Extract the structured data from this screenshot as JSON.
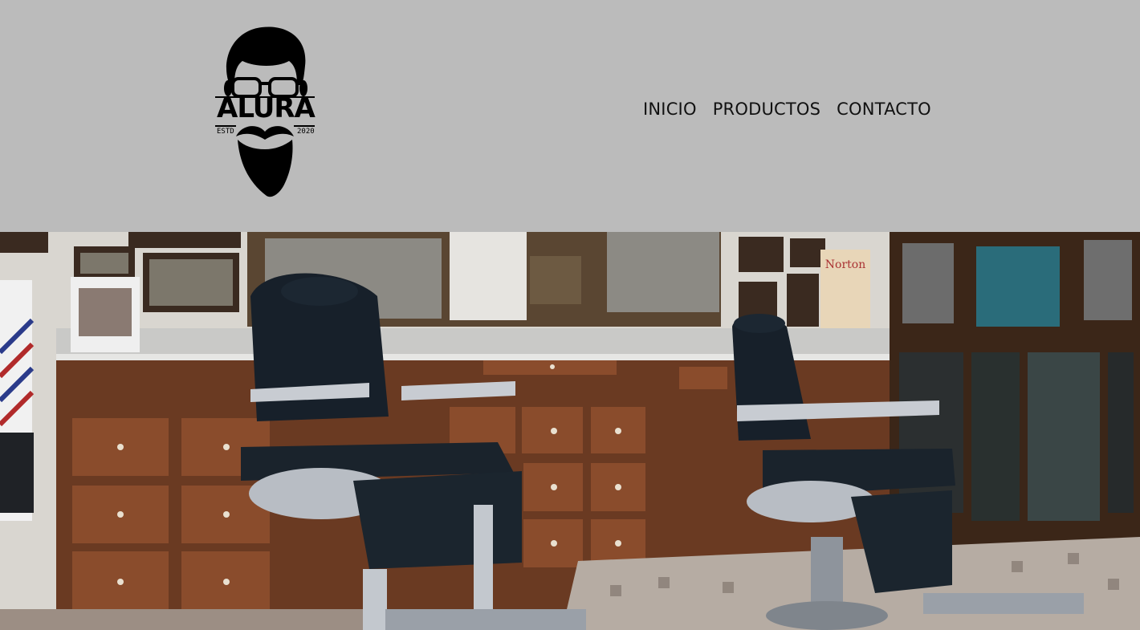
{
  "brand": {
    "name": "ALURA",
    "estd_label": "ESTD",
    "year": "2020",
    "logo_icon": "bearded-man-with-glasses-icon"
  },
  "nav": {
    "items": [
      {
        "label": "INICIO"
      },
      {
        "label": "PRODUCTOS"
      },
      {
        "label": "CONTACTO"
      }
    ]
  },
  "hero": {
    "image_icon": "barbershop-photo",
    "sign_text": "Norton"
  },
  "colors": {
    "header_bg": "#bbbbbb",
    "nav_text": "#111111"
  }
}
